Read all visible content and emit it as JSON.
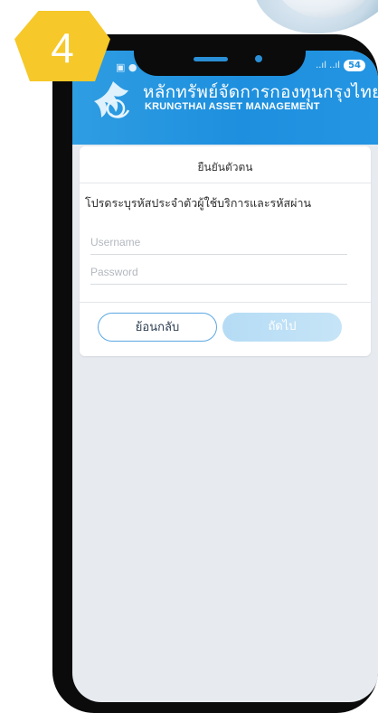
{
  "step": {
    "number": "4"
  },
  "status_bar": {
    "battery": "54",
    "signal": "..ıl ..ıl"
  },
  "header": {
    "brand_thai": "หลักทรัพย์จัดการกองทุนกรุงไทย",
    "brand_english": "KRUNGTHAI ASSET MANAGEMENT",
    "brand_color": "#1d8fde"
  },
  "login_card": {
    "title": "ยืนยันตัวตน",
    "instruction": "โปรดระบุรหัสประจำตัวผู้ใช้บริการและรหัสผ่าน",
    "username": {
      "value": "",
      "placeholder": "Username"
    },
    "password": {
      "value": "",
      "placeholder": "Password"
    },
    "back_button": "ย้อนกลับ",
    "next_button": "ถัดไป"
  },
  "colors": {
    "step_badge": "#f6c829",
    "screen_background": "#e7ebf0",
    "next_button_disabled": "#b5dcf5",
    "back_button_border": "#5aa7e3"
  },
  "icons": [
    "krungthai-logo-icon",
    "battery-icon",
    "signal-icon"
  ]
}
